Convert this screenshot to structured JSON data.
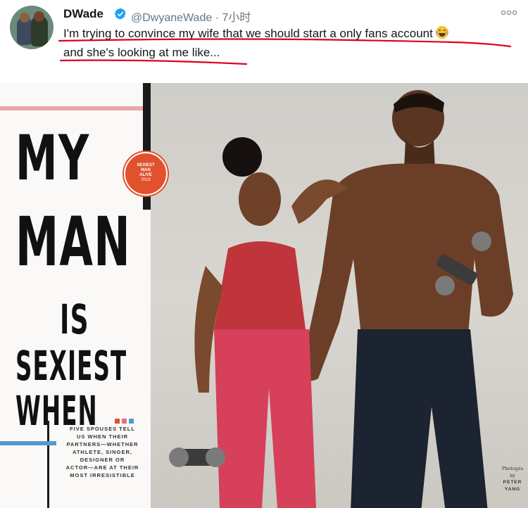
{
  "tweet": {
    "display_name": "DWade",
    "handle": "@DwyaneWade",
    "separator": "·",
    "time": "7小时",
    "text_line1": "I'm trying to convince my wife that we should start a only fans account",
    "text_line2": "and she's looking at me like...",
    "emoji_icon": "face-with-tears-of-joy",
    "verified_color": "#1da1f2",
    "annotation_color": "#e0001b"
  },
  "image": {
    "badge_lines": [
      "SEXIEST",
      "MAN",
      "ALIVE",
      "2019"
    ],
    "headline": {
      "line1": "MY",
      "line2": "MAN",
      "line3": "IS",
      "line4": "SEXIEST",
      "line5": "WHEN",
      "ellipsis_colors": [
        "#e0512c",
        "#e86b8f",
        "#4f9bcf"
      ]
    },
    "teaser_lines": [
      "FIVE SPOUSES TELL",
      "US WHEN THEIR",
      "PARTNERS—WHETHER",
      "ATHLETE, SINGER,",
      "DESIGNER OR",
      "ACTOR—ARE AT THEIR",
      "MOST IRRESISTIBLE"
    ],
    "credit_lines": [
      "Photogra",
      "by",
      "PETER",
      "YANG"
    ]
  }
}
